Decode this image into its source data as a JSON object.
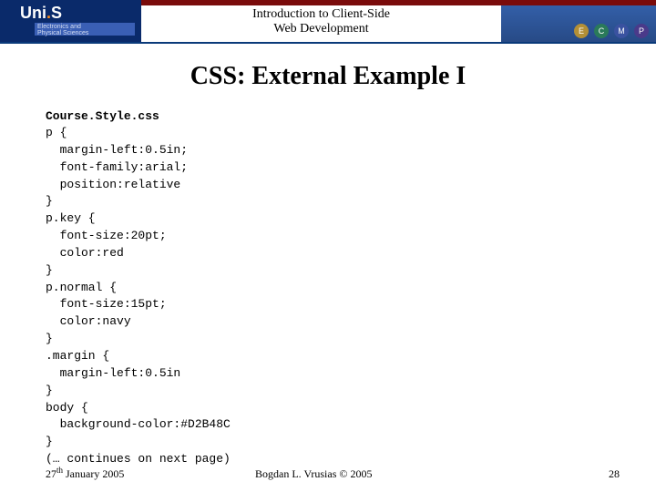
{
  "header": {
    "uni_prefix": "Uni",
    "uni_suffix": "S",
    "dept_line1": "Electronics and",
    "dept_line2": "Physical Sciences",
    "course_line1": "Introduction to Client-Side",
    "course_line2": "Web Development",
    "circles": {
      "c1": "E",
      "c2": "C",
      "c3": "M",
      "c4": "P"
    }
  },
  "title": "CSS: External Example I",
  "code": {
    "filename": "Course.Style.css",
    "body": "p {\n  margin-left:0.5in;\n  font-family:arial;\n  position:relative\n}\np.key {\n  font-size:20pt;\n  color:red\n}\np.normal {\n  font-size:15pt;\n  color:navy\n}\n.margin {\n  margin-left:0.5in\n}\nbody {\n  background-color:#D2B48C\n}\n(… continues on next page)"
  },
  "footer": {
    "date_day": "27",
    "date_th": "th",
    "date_rest": " January 2005",
    "author": "Bogdan L. Vrusias © 2005",
    "page": "28"
  }
}
